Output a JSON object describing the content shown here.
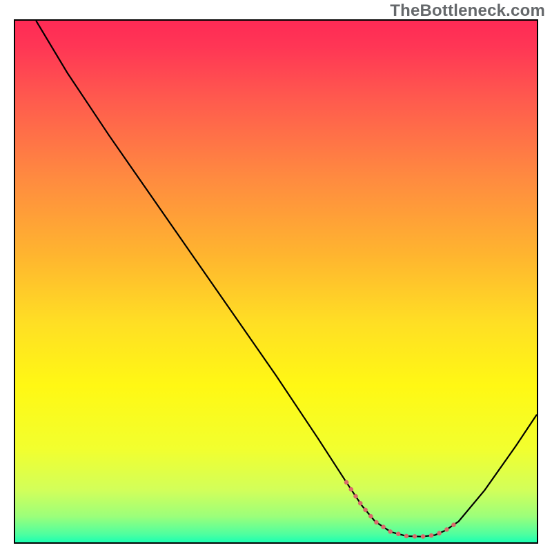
{
  "watermark": "TheBottleneck.com",
  "chart_data": {
    "type": "line",
    "title": "",
    "xlabel": "",
    "ylabel": "",
    "xlim": [
      0,
      100
    ],
    "ylim": [
      0,
      100
    ],
    "grid": false,
    "legend": false,
    "background_gradient_stops": [
      {
        "offset": 0.0,
        "color": "#ff2a55"
      },
      {
        "offset": 0.05,
        "color": "#ff3655"
      },
      {
        "offset": 0.15,
        "color": "#ff5a4e"
      },
      {
        "offset": 0.3,
        "color": "#ff8a40"
      },
      {
        "offset": 0.45,
        "color": "#ffb52f"
      },
      {
        "offset": 0.58,
        "color": "#ffdf24"
      },
      {
        "offset": 0.7,
        "color": "#fff814"
      },
      {
        "offset": 0.82,
        "color": "#f2ff2e"
      },
      {
        "offset": 0.9,
        "color": "#d2ff5a"
      },
      {
        "offset": 0.95,
        "color": "#9cff7a"
      },
      {
        "offset": 0.985,
        "color": "#4dffa0"
      },
      {
        "offset": 1.0,
        "color": "#1cffb2"
      }
    ],
    "series": [
      {
        "name": "curve",
        "stroke": "#000000",
        "stroke_width": 2.2,
        "x": [
          4,
          10,
          18,
          26,
          34,
          42,
          50,
          58,
          63.5,
          66.5,
          69,
          72,
          75,
          78,
          80.5,
          82.5,
          85,
          90,
          96,
          100
        ],
        "y": [
          100,
          90,
          78,
          66.5,
          55,
          43.5,
          32,
          20,
          11.5,
          7,
          4,
          2,
          1.2,
          1.1,
          1.4,
          2.3,
          4,
          10,
          18.5,
          24.5
        ]
      },
      {
        "name": "dotted-valley",
        "stroke": "#d86a6a",
        "stroke_width": 6.5,
        "dashed": true,
        "dash": "0.1 12",
        "linecap": "round",
        "x": [
          63.5,
          66.5,
          69,
          72,
          75,
          78,
          80.5,
          82.5,
          85
        ],
        "y": [
          11.5,
          7,
          4,
          2,
          1.2,
          1.1,
          1.4,
          2.3,
          4
        ]
      }
    ]
  }
}
